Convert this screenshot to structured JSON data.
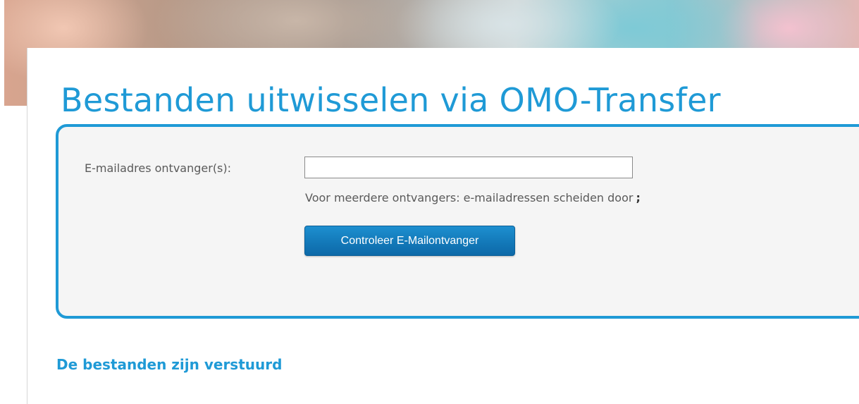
{
  "colors": {
    "accent": "#1f9ad6",
    "button": "#1379b9",
    "box_background": "#f5f5f5",
    "label_text": "#5a5a5a"
  },
  "page": {
    "title": "Bestanden uitwisselen via OMO-Transfer"
  },
  "form": {
    "recipient_label": "E-mailadres ontvanger(s):",
    "recipient_value": "",
    "help_text": "Voor meerdere ontvangers: e-mailadressen scheiden door",
    "help_separator": ";",
    "check_button_label": "Controleer E-Mailontvanger"
  },
  "status": {
    "message": "De bestanden zijn verstuurd"
  }
}
